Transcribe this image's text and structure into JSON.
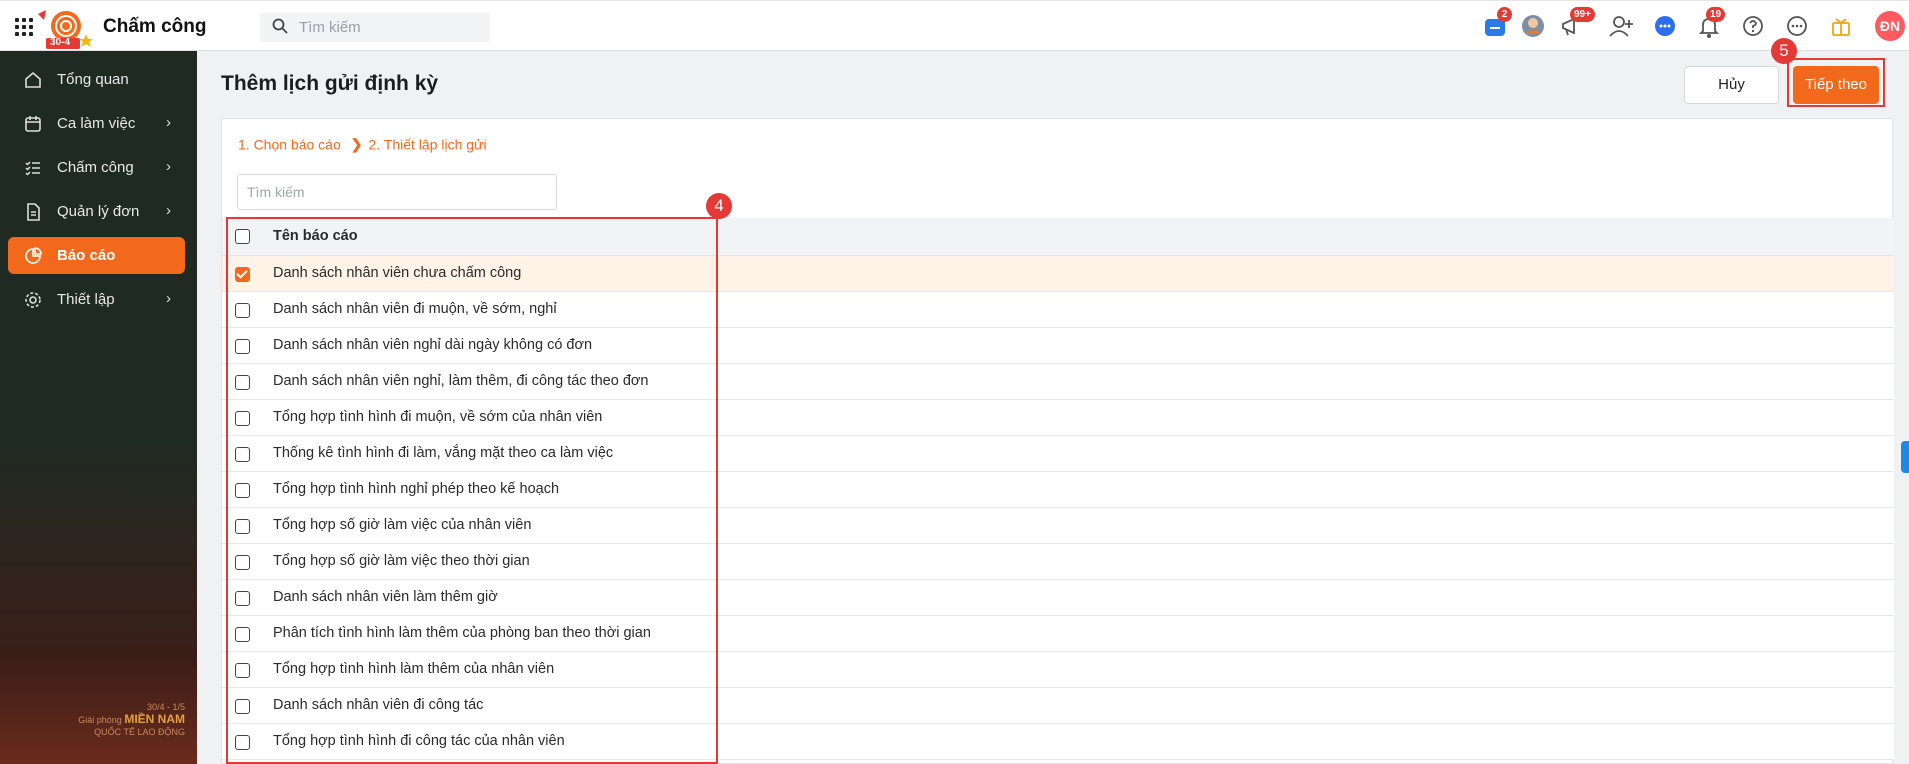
{
  "app": {
    "title": "Chấm công",
    "logo_badge": "30-4"
  },
  "topbar": {
    "search_placeholder": "Tìm kiếm",
    "cart_badge": "2",
    "announce_badge": "99+",
    "notify_badge": "19",
    "user_initials": "ĐN"
  },
  "sidebar": {
    "items": [
      {
        "label": "Tổng quan",
        "icon": "home-icon"
      },
      {
        "label": "Ca làm việc",
        "icon": "calendar-icon"
      },
      {
        "label": "Chấm công",
        "icon": "checklist-icon"
      },
      {
        "label": "Quản lý đơn",
        "icon": "document-icon"
      },
      {
        "label": "Báo cáo",
        "icon": "pie-chart-icon",
        "active": true
      },
      {
        "label": "Thiết lập",
        "icon": "gear-icon"
      }
    ],
    "promo": {
      "line1": "30/4 - 1/5",
      "line2_prefix": "Giải phóng",
      "line2_big": "MIỀN NAM",
      "line3": "QUỐC TẾ LAO ĐỘNG"
    }
  },
  "main": {
    "page_title": "Thêm lịch gửi định kỳ",
    "cancel_label": "Hủy",
    "next_label": "Tiếp theo",
    "markers": {
      "next": "5",
      "table": "4"
    },
    "steps": {
      "step1": "1. Chọn báo cáo",
      "step2": "2. Thiết lập lịch gửi"
    },
    "search_placeholder": "Tìm kiếm",
    "table": {
      "header": "Tên báo cáo",
      "rows": [
        {
          "name": "Danh sách nhân viên chưa chấm công",
          "checked": true
        },
        {
          "name": "Danh sách nhân viên đi muộn, về sớm, nghỉ",
          "checked": false
        },
        {
          "name": "Danh sách nhân viên nghỉ dài ngày không có đơn",
          "checked": false
        },
        {
          "name": "Danh sách nhân viên nghỉ, làm thêm, đi công tác theo đơn",
          "checked": false
        },
        {
          "name": "Tổng hợp tình hình đi muộn, về sớm của nhân viên",
          "checked": false
        },
        {
          "name": "Thống kê tình hình đi làm, vắng mặt theo ca làm việc",
          "checked": false
        },
        {
          "name": "Tổng hợp tình hình nghỉ phép theo kế hoạch",
          "checked": false
        },
        {
          "name": "Tổng hợp số giờ làm việc của nhân viên",
          "checked": false
        },
        {
          "name": "Tổng hợp số giờ làm việc theo thời gian",
          "checked": false
        },
        {
          "name": "Danh sách nhân viên làm thêm giờ",
          "checked": false
        },
        {
          "name": "Phân tích tình hình làm thêm của phòng ban theo thời gian",
          "checked": false
        },
        {
          "name": "Tổng hợp tình hình làm thêm của nhân viên",
          "checked": false
        },
        {
          "name": "Danh sách nhân viên đi công tác",
          "checked": false
        },
        {
          "name": "Tổng hợp tình hình đi công tác của nhân viên",
          "checked": false
        }
      ]
    }
  },
  "colors": {
    "accent": "#f3691c",
    "annotation": "#e53935"
  }
}
